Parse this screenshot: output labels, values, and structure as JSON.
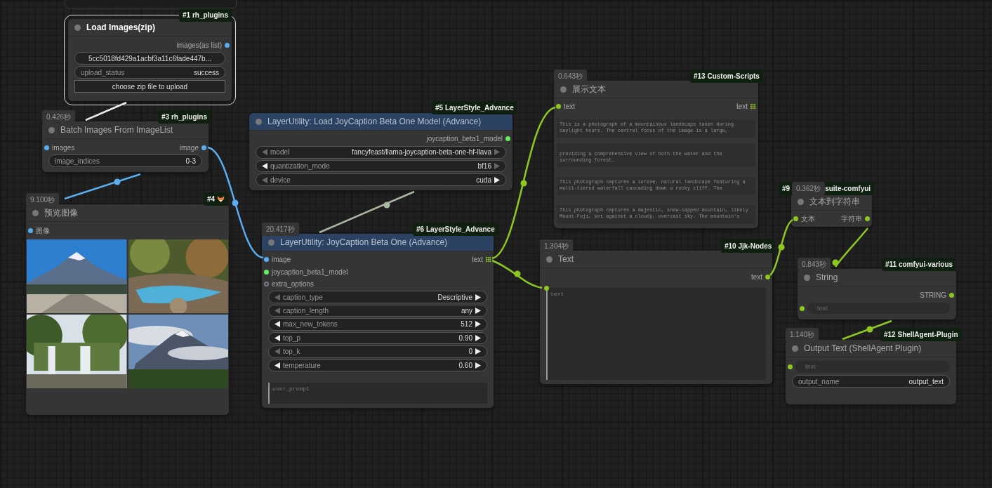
{
  "nodes": [
    {
      "badge": "#1 rh_plugins",
      "selected": true,
      "color": "#353535",
      "title": "Load Images(zip)",
      "rows": [
        {
          "right": {
            "label": "images(as list)"
          }
        }
      ],
      "widgets": [
        {
          "kind": "value",
          "value": "5cc5018fd429a1acbf3a11c6fade447b..."
        },
        {
          "kind": "pair",
          "label": "upload_status",
          "value": "success"
        },
        {
          "kind": "button",
          "label": "choose zip file to upload"
        }
      ]
    },
    {
      "badge": "#3 rh_plugins",
      "time": "0.426秒",
      "selected": false,
      "color": "#353535",
      "title": "Batch Images From ImageList",
      "rows": [
        {
          "left": {
            "label": "images"
          },
          "right": {
            "label": "image"
          }
        }
      ],
      "widgets": [
        {
          "kind": "pair",
          "label": "image_indices",
          "value": "0-3"
        }
      ]
    },
    {
      "badge": "#4",
      "badge_icon": true,
      "time": "9.100秒",
      "selected": false,
      "color": "#353535",
      "title": "预览图像",
      "rows": [
        {
          "left": {
            "label": "图像"
          }
        }
      ],
      "widgets": [
        {
          "kind": "images"
        }
      ]
    },
    {
      "badge": "#5 LayerStyle_Advance",
      "selected": false,
      "color": "#2b4263",
      "title": "LayerUtility: Load JoyCaption Beta One Model (Advance)",
      "rows": [
        {
          "right": {
            "label": "joycaption_beta1_model",
            "kind": "model"
          }
        }
      ],
      "widgets": [
        {
          "kind": "combo",
          "label": "model",
          "value": "fancyfeast/llama-joycaption-beta-one-hf-llava",
          "prev": false,
          "next": false
        },
        {
          "kind": "combo",
          "label": "quantization_mode",
          "value": "bf16",
          "prev": true,
          "next": false
        },
        {
          "kind": "combo",
          "label": "device",
          "value": "cuda",
          "prev": false,
          "next": true
        }
      ]
    },
    {
      "badge": "#6 LayerStyle_Advance",
      "time": "20.417秒",
      "selected": false,
      "color": "#2b4263",
      "title": "LayerUtility: JoyCaption Beta One (Advance)",
      "rows": [
        {
          "left": {
            "label": "image"
          },
          "right": {
            "label": "text",
            "kind": "list"
          }
        },
        {
          "left": {
            "label": "joycaption_beta1_model",
            "kind": "model"
          }
        },
        {
          "left": {
            "label": "extra_options",
            "kind": "optional"
          }
        }
      ],
      "widgets": [
        {
          "kind": "combo",
          "label": "caption_type",
          "value": "Descriptive",
          "prev": false,
          "next": true
        },
        {
          "kind": "combo",
          "label": "caption_length",
          "value": "any",
          "prev": false,
          "next": true
        },
        {
          "kind": "combo",
          "label": "max_new_tokens",
          "value": "512",
          "prev": true,
          "next": true
        },
        {
          "kind": "combo",
          "label": "top_p",
          "value": "0.90",
          "prev": true,
          "next": true
        },
        {
          "kind": "combo",
          "label": "top_k",
          "value": "0",
          "prev": false,
          "next": true
        },
        {
          "kind": "combo",
          "label": "temperature",
          "value": "0.60",
          "prev": true,
          "next": true
        },
        {
          "kind": "textarea",
          "placeholder": "user_prompt",
          "linked": false
        }
      ]
    },
    {
      "badge": "#13 Custom-Scripts",
      "time": "0.643秒",
      "selected": false,
      "color": "#353535",
      "title": "展示文本",
      "rows": [
        {
          "left": {
            "label": "text",
            "kind": "string"
          },
          "right": {
            "label": "text",
            "kind": "list"
          }
        }
      ],
      "widgets": [
        {
          "kind": "display",
          "lines": [
            "This is a photograph of a mountainous landscape taken during",
            "daylight hours. The central focus of the image is a large,"
          ]
        },
        {
          "kind": "display",
          "lines": [
            "providing a comprehensive view of both the water and the",
            "surrounding forest."
          ]
        },
        {
          "kind": "display",
          "lines": [
            "This photograph captures a serene, natural landscape featuring a",
            "multi-tiered waterfall cascading down a rocky cliff. The"
          ]
        },
        {
          "kind": "display",
          "lines": [
            "This photograph captures a majestic, snow-capped mountain, likely",
            "Mount Fuji, set against a cloudy, overcast sky. The mountain's"
          ]
        }
      ]
    },
    {
      "badge": "#10 Jjk-Nodes",
      "time": "1.304秒",
      "selected": false,
      "color": "#353535",
      "title": "Text",
      "rows": [
        {
          "right": {
            "label": "text",
            "kind": "string"
          }
        }
      ],
      "widgets": [
        {
          "kind": "textarea",
          "placeholder": "text",
          "linked": true
        }
      ]
    },
    {
      "badge_parts": [
        "#9",
        "suite-comfyui"
      ],
      "time": "0.362秒",
      "selected": false,
      "color": "#353535",
      "title": "文本到字符串",
      "rows": [
        {
          "left": {
            "label": "文本",
            "kind": "string"
          },
          "right": {
            "label": "字符串",
            "kind": "string"
          }
        }
      ]
    },
    {
      "badge": "#11 comfyui-various",
      "time": "0.843秒",
      "selected": false,
      "color": "#353535",
      "title": "String",
      "rows": [
        {
          "right": {
            "label": "STRING",
            "kind": "string"
          }
        }
      ],
      "widgets": [
        {
          "kind": "input",
          "placeholder": "text"
        }
      ]
    },
    {
      "badge": "#12 ShellAgent-Plugin",
      "time": "1.140秒",
      "selected": false,
      "color": "#353535",
      "title": "Output Text (ShellAgent Plugin)",
      "widgets": [
        {
          "kind": "input",
          "placeholder": "text"
        },
        {
          "kind": "pair",
          "label": "output_name",
          "value": "output_text"
        }
      ]
    }
  ]
}
